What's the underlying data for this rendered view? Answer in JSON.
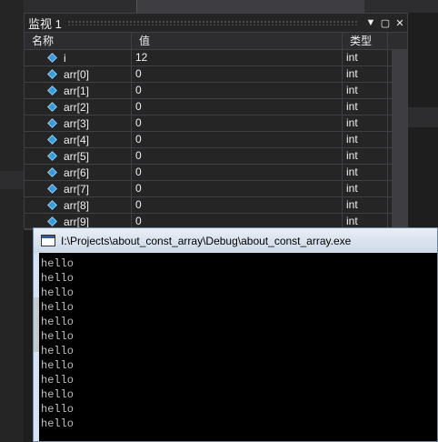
{
  "watch": {
    "title": "监视 1",
    "controls": {
      "dropdown": "▼",
      "pin": "▢",
      "close": "✕"
    },
    "columns": {
      "name": "名称",
      "value": "值",
      "type": "类型"
    },
    "rows": [
      {
        "name": "i",
        "value": "12",
        "type": "int"
      },
      {
        "name": "arr[0]",
        "value": "0",
        "type": "int"
      },
      {
        "name": "arr[1]",
        "value": "0",
        "type": "int"
      },
      {
        "name": "arr[2]",
        "value": "0",
        "type": "int"
      },
      {
        "name": "arr[3]",
        "value": "0",
        "type": "int"
      },
      {
        "name": "arr[4]",
        "value": "0",
        "type": "int"
      },
      {
        "name": "arr[5]",
        "value": "0",
        "type": "int"
      },
      {
        "name": "arr[6]",
        "value": "0",
        "type": "int"
      },
      {
        "name": "arr[7]",
        "value": "0",
        "type": "int"
      },
      {
        "name": "arr[8]",
        "value": "0",
        "type": "int"
      },
      {
        "name": "arr[9]",
        "value": "0",
        "type": "int"
      }
    ]
  },
  "console": {
    "title": "I:\\Projects\\about_const_array\\Debug\\about_const_array.exe",
    "lines": [
      "hello",
      "hello",
      "hello",
      "hello",
      "hello",
      "hello",
      "hello",
      "hello",
      "hello",
      "hello",
      "hello",
      "hello"
    ]
  }
}
